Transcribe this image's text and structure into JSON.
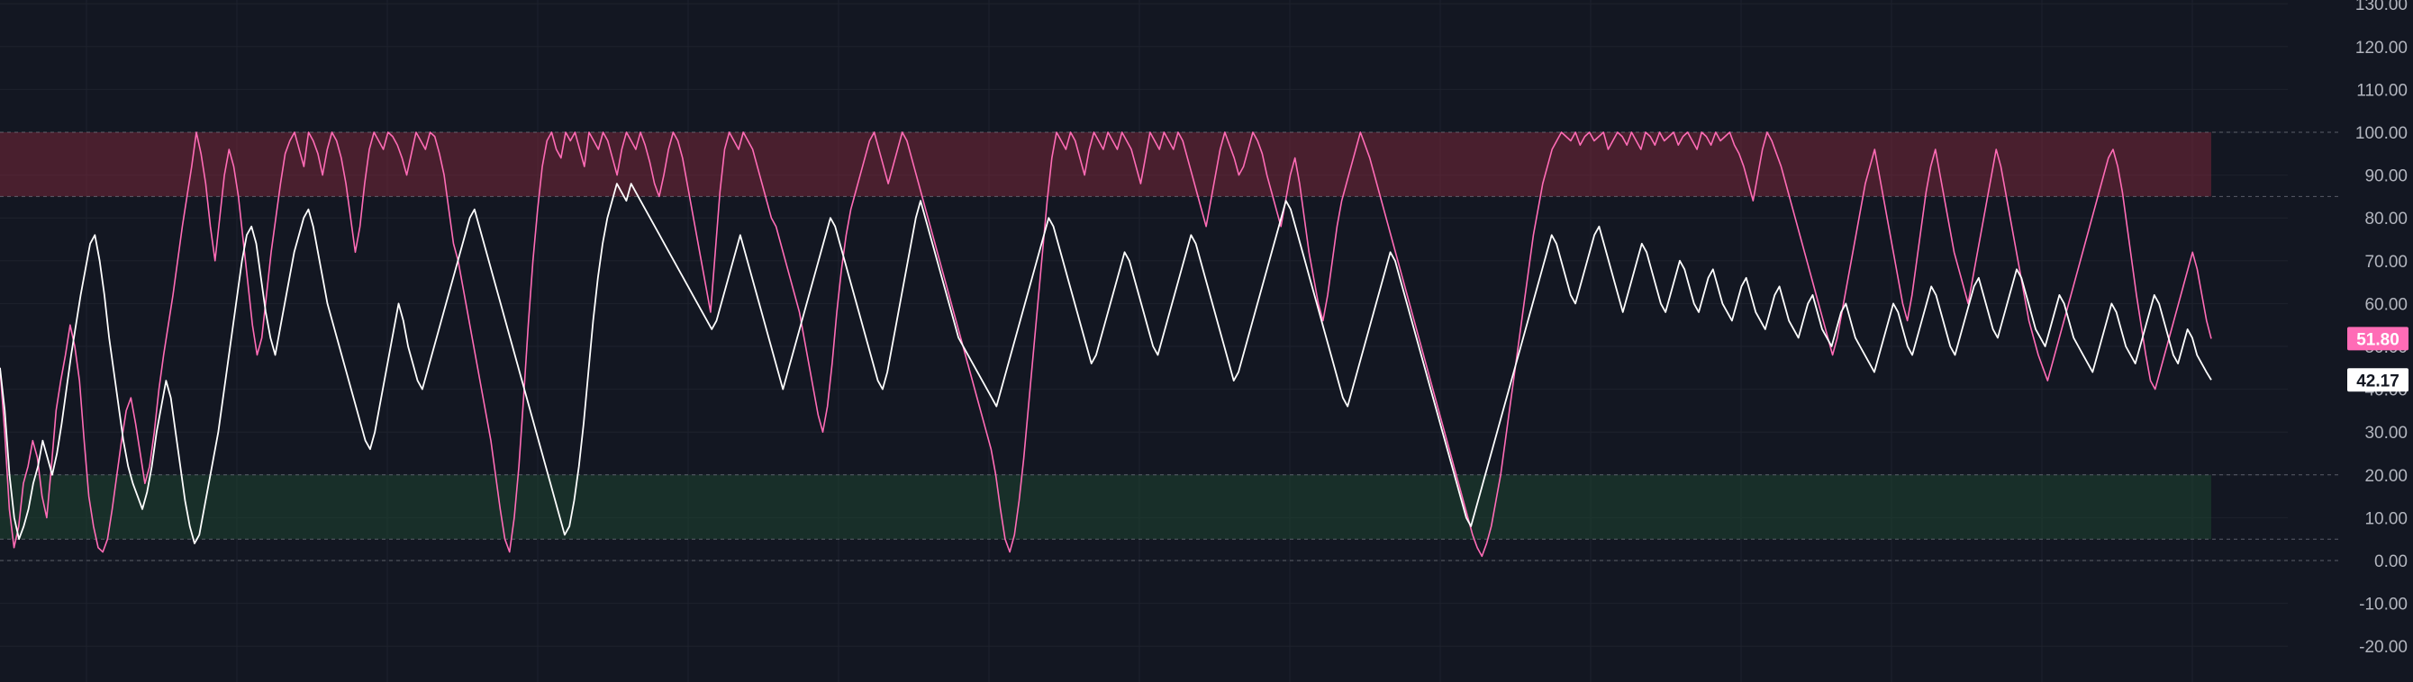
{
  "chart_data": {
    "type": "line",
    "title": "",
    "xlabel": "",
    "ylabel": "",
    "ylim": [
      -25,
      130
    ],
    "yticks": [
      -20,
      -10,
      0,
      10,
      20,
      30,
      40,
      50,
      60,
      70,
      80,
      90,
      100,
      110,
      120,
      130
    ],
    "ytick_labels": [
      "-20.00",
      "-10.00",
      "0.00",
      "10.00",
      "20.00",
      "30.00",
      "40.00",
      "50.00",
      "60.00",
      "70.00",
      "80.00",
      "90.00",
      "100.00",
      "110.00",
      "120.00",
      "130.00"
    ],
    "grid": true,
    "bands": [
      {
        "from": 85,
        "to": 100,
        "color": "#8b2a3e"
      },
      {
        "from": 5,
        "to": 20,
        "color": "#1e4d33"
      }
    ],
    "reference_lines": [
      100,
      85,
      20,
      5,
      0
    ],
    "n_points": 460,
    "series": [
      {
        "color": "#ff6cb6",
        "last_value_label": "51.80",
        "values": [
          45,
          30,
          12,
          3,
          8,
          18,
          22,
          28,
          24,
          15,
          10,
          22,
          35,
          42,
          48,
          55,
          50,
          42,
          28,
          15,
          8,
          3,
          2,
          5,
          12,
          20,
          28,
          35,
          38,
          32,
          25,
          18,
          22,
          30,
          40,
          48,
          55,
          62,
          70,
          78,
          85,
          92,
          100,
          95,
          88,
          78,
          70,
          80,
          90,
          96,
          92,
          85,
          75,
          65,
          55,
          48,
          52,
          62,
          72,
          80,
          88,
          95,
          98,
          100,
          96,
          92,
          100,
          98,
          95,
          90,
          96,
          100,
          98,
          94,
          88,
          80,
          72,
          78,
          88,
          96,
          100,
          98,
          96,
          100,
          99,
          97,
          94,
          90,
          95,
          100,
          98,
          96,
          100,
          99,
          95,
          90,
          82,
          74,
          70,
          64,
          58,
          52,
          46,
          40,
          34,
          28,
          20,
          12,
          5,
          2,
          10,
          22,
          38,
          55,
          70,
          82,
          92,
          98,
          100,
          96,
          94,
          100,
          98,
          100,
          96,
          92,
          100,
          98,
          96,
          100,
          98,
          94,
          90,
          96,
          100,
          98,
          96,
          100,
          97,
          93,
          88,
          85,
          90,
          96,
          100,
          98,
          94,
          88,
          82,
          76,
          70,
          64,
          58,
          72,
          86,
          96,
          100,
          98,
          96,
          100,
          98,
          96,
          92,
          88,
          84,
          80,
          78,
          74,
          70,
          66,
          62,
          58,
          52,
          46,
          40,
          34,
          30,
          36,
          46,
          58,
          68,
          76,
          82,
          86,
          90,
          94,
          98,
          100,
          96,
          92,
          88,
          92,
          96,
          100,
          98,
          94,
          90,
          86,
          82,
          78,
          74,
          70,
          66,
          62,
          58,
          54,
          50,
          46,
          42,
          38,
          34,
          30,
          26,
          20,
          12,
          5,
          2,
          6,
          14,
          24,
          36,
          48,
          60,
          72,
          84,
          94,
          100,
          98,
          96,
          100,
          98,
          94,
          90,
          96,
          100,
          98,
          96,
          100,
          98,
          96,
          100,
          98,
          96,
          92,
          88,
          94,
          100,
          98,
          96,
          100,
          98,
          96,
          100,
          98,
          94,
          90,
          86,
          82,
          78,
          84,
          90,
          96,
          100,
          97,
          94,
          90,
          92,
          96,
          100,
          98,
          95,
          90,
          86,
          82,
          78,
          84,
          90,
          94,
          88,
          80,
          72,
          66,
          60,
          56,
          62,
          70,
          78,
          84,
          88,
          92,
          96,
          100,
          97,
          94,
          90,
          86,
          82,
          78,
          74,
          70,
          66,
          62,
          58,
          54,
          50,
          46,
          42,
          38,
          34,
          30,
          26,
          22,
          18,
          14,
          10,
          6,
          3,
          1,
          4,
          8,
          14,
          20,
          28,
          36,
          44,
          52,
          60,
          68,
          76,
          82,
          88,
          92,
          96,
          98,
          100,
          99,
          98,
          100,
          97,
          99,
          100,
          98,
          99,
          100,
          96,
          98,
          100,
          99,
          97,
          100,
          98,
          96,
          100,
          99,
          97,
          100,
          98,
          99,
          100,
          97,
          99,
          100,
          98,
          96,
          100,
          99,
          97,
          100,
          98,
          99,
          100,
          97,
          95,
          92,
          88,
          84,
          90,
          96,
          100,
          98,
          95,
          92,
          88,
          84,
          80,
          76,
          72,
          68,
          64,
          60,
          56,
          52,
          48,
          52,
          58,
          64,
          70,
          76,
          82,
          88,
          92,
          96,
          90,
          84,
          78,
          72,
          66,
          60,
          56,
          62,
          70,
          78,
          86,
          92,
          96,
          90,
          84,
          78,
          72,
          68,
          64,
          60,
          66,
          72,
          78,
          84,
          90,
          96,
          92,
          86,
          80,
          74,
          68,
          62,
          56,
          52,
          48,
          45,
          42,
          46,
          50,
          54,
          58,
          62,
          66,
          70,
          74,
          78,
          82,
          86,
          90,
          94,
          96,
          92,
          86,
          78,
          70,
          62,
          55,
          48,
          42,
          40,
          44,
          48,
          52,
          56,
          60,
          64,
          68,
          72,
          68,
          62,
          56,
          51.8
        ]
      },
      {
        "color": "#ffffff",
        "last_value_label": "42.17",
        "values": [
          45,
          35,
          20,
          10,
          5,
          8,
          12,
          18,
          22,
          28,
          24,
          20,
          25,
          32,
          40,
          48,
          55,
          62,
          68,
          74,
          76,
          70,
          62,
          52,
          44,
          36,
          28,
          22,
          18,
          15,
          12,
          16,
          22,
          30,
          36,
          42,
          38,
          30,
          22,
          14,
          8,
          4,
          6,
          12,
          18,
          24,
          30,
          38,
          46,
          54,
          62,
          70,
          76,
          78,
          74,
          66,
          58,
          52,
          48,
          54,
          60,
          66,
          72,
          76,
          80,
          82,
          78,
          72,
          66,
          60,
          56,
          52,
          48,
          44,
          40,
          36,
          32,
          28,
          26,
          30,
          36,
          42,
          48,
          54,
          60,
          56,
          50,
          46,
          42,
          40,
          44,
          48,
          52,
          56,
          60,
          64,
          68,
          72,
          76,
          80,
          82,
          78,
          74,
          70,
          66,
          62,
          58,
          54,
          50,
          46,
          42,
          38,
          34,
          30,
          26,
          22,
          18,
          14,
          10,
          6,
          8,
          14,
          22,
          32,
          44,
          56,
          66,
          74,
          80,
          84,
          88,
          86,
          84,
          88,
          86,
          84,
          82,
          80,
          78,
          76,
          74,
          72,
          70,
          68,
          66,
          64,
          62,
          60,
          58,
          56,
          54,
          56,
          60,
          64,
          68,
          72,
          76,
          72,
          68,
          64,
          60,
          56,
          52,
          48,
          44,
          40,
          44,
          48,
          52,
          56,
          60,
          64,
          68,
          72,
          76,
          80,
          78,
          74,
          70,
          66,
          62,
          58,
          54,
          50,
          46,
          42,
          40,
          44,
          50,
          56,
          62,
          68,
          74,
          80,
          84,
          80,
          76,
          72,
          68,
          64,
          60,
          56,
          52,
          50,
          48,
          46,
          44,
          42,
          40,
          38,
          36,
          40,
          44,
          48,
          52,
          56,
          60,
          64,
          68,
          72,
          76,
          80,
          78,
          74,
          70,
          66,
          62,
          58,
          54,
          50,
          46,
          48,
          52,
          56,
          60,
          64,
          68,
          72,
          70,
          66,
          62,
          58,
          54,
          50,
          48,
          52,
          56,
          60,
          64,
          68,
          72,
          76,
          74,
          70,
          66,
          62,
          58,
          54,
          50,
          46,
          42,
          44,
          48,
          52,
          56,
          60,
          64,
          68,
          72,
          76,
          80,
          84,
          82,
          78,
          74,
          70,
          66,
          62,
          58,
          54,
          50,
          46,
          42,
          38,
          36,
          40,
          44,
          48,
          52,
          56,
          60,
          64,
          68,
          72,
          70,
          66,
          62,
          58,
          54,
          50,
          46,
          42,
          38,
          34,
          30,
          26,
          22,
          18,
          14,
          10,
          8,
          12,
          16,
          20,
          24,
          28,
          32,
          36,
          40,
          44,
          48,
          52,
          56,
          60,
          64,
          68,
          72,
          76,
          74,
          70,
          66,
          62,
          60,
          64,
          68,
          72,
          76,
          78,
          74,
          70,
          66,
          62,
          58,
          62,
          66,
          70,
          74,
          72,
          68,
          64,
          60,
          58,
          62,
          66,
          70,
          68,
          64,
          60,
          58,
          62,
          66,
          68,
          64,
          60,
          58,
          56,
          60,
          64,
          66,
          62,
          58,
          56,
          54,
          58,
          62,
          64,
          60,
          56,
          54,
          52,
          56,
          60,
          62,
          58,
          54,
          52,
          50,
          54,
          58,
          60,
          56,
          52,
          50,
          48,
          46,
          44,
          48,
          52,
          56,
          60,
          58,
          54,
          50,
          48,
          52,
          56,
          60,
          64,
          62,
          58,
          54,
          50,
          48,
          52,
          56,
          60,
          64,
          66,
          62,
          58,
          54,
          52,
          56,
          60,
          64,
          68,
          66,
          62,
          58,
          54,
          52,
          50,
          54,
          58,
          62,
          60,
          56,
          52,
          50,
          48,
          46,
          44,
          48,
          52,
          56,
          60,
          58,
          54,
          50,
          48,
          46,
          50,
          54,
          58,
          62,
          60,
          56,
          52,
          48,
          46,
          50,
          54,
          52,
          48,
          46,
          44,
          42.17
        ]
      }
    ]
  }
}
